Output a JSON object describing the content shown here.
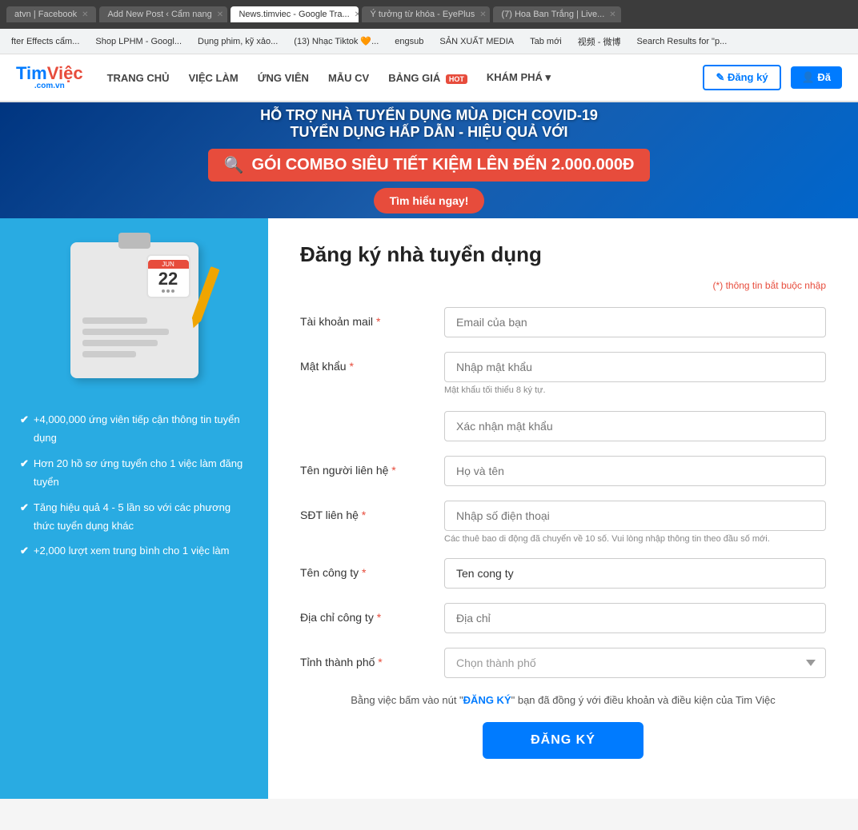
{
  "browser": {
    "tabs": [
      {
        "label": "atvn | Facebook",
        "active": false
      },
      {
        "label": "Add New Post ‹ Cẩm nang",
        "active": false
      },
      {
        "label": "News.timviec - Google Tra...",
        "active": true
      },
      {
        "label": "Ý tưởng từ khóa - EyePlus",
        "active": false
      },
      {
        "label": "(7) Hoa Ban Trắng | Live...",
        "active": false
      }
    ],
    "bookmarks": [
      "fter Effects cẩm...",
      "Shop LPHM - Googl...",
      "Dụng phim, kỹ xảo...",
      "(13) Nhạc Tiktok 🧡...",
      "engsub",
      "SẢN XUẤT MEDIA",
      "Tab mới",
      "视频 - 微博",
      "Search Results for \"p..."
    ]
  },
  "header": {
    "logo": "TimViệc",
    "logo_sub": ".com.vn",
    "nav": [
      {
        "label": "TRANG CHỦ"
      },
      {
        "label": "VIỆC LÀM"
      },
      {
        "label": "ỨNG VIÊN"
      },
      {
        "label": "MẪU CV"
      },
      {
        "label": "BẢNG GIÁ",
        "badge": "HOT"
      },
      {
        "label": "KHÁM PHÁ ▾"
      }
    ],
    "register_label": "Đăng ký",
    "login_label": "Đă"
  },
  "banner": {
    "line1": "HỖ TRỢ NHÀ TUYỂN DỤNG MÙA DỊCH COVID-19",
    "line2": "TUYỂN DỤNG HẤP DẪN - HIỆU QUẢ VỚI",
    "offer": "GÓI COMBO SIÊU TIẾT KIỆM LÊN ĐẾN 2.000.000Đ",
    "cta": "Tìm hiểu ngay!"
  },
  "left_panel": {
    "features": [
      "+4,000,000 ứng viên tiếp cận thông tin tuyển dụng",
      "Hơn 20 hồ sơ ứng tuyển cho 1 việc làm đăng tuyển",
      "Tăng hiệu quả 4 - 5 lần so với các phương thức tuyển dụng khác",
      "+2,000 lượt xem trung bình cho 1 việc làm"
    ]
  },
  "form": {
    "title": "Đăng ký nhà tuyển dụng",
    "required_note": "(*) thông tin bắt buộc nhập",
    "fields": {
      "email_label": "Tài khoản mail",
      "email_placeholder": "Email của bạn",
      "password_label": "Mật khẩu",
      "password_placeholder": "Nhập mật khẩu",
      "password_hint": "Mật khẩu tối thiểu 8 ký tự.",
      "confirm_password_placeholder": "Xác nhận mật khẩu",
      "contact_name_label": "Tên người liên hệ",
      "contact_name_placeholder": "Họ và tên",
      "phone_label": "SĐT liên hệ",
      "phone_placeholder": "Nhập số điện thoại",
      "phone_hint": "Các thuê bao di động đã chuyển về 10 số. Vui lòng nhập thông tin theo đầu số mới.",
      "company_name_label": "Tên công ty",
      "company_name_placeholder": "Tên công ty",
      "company_name_value": "Ten cong ty",
      "address_label": "Địa chỉ công ty",
      "address_placeholder": "Địa chỉ",
      "city_label": "Tỉnh thành phố",
      "city_placeholder": "Chọn thành phố"
    },
    "terms": "Bằng việc bấm vào nút \"ĐĂNG KÝ\" bạn đã đồng ý với điều khoản và điều kiện của Tim Việc",
    "terms_highlight": "ĐĂNG KÝ",
    "submit_label": "ĐĂNG KÝ"
  }
}
